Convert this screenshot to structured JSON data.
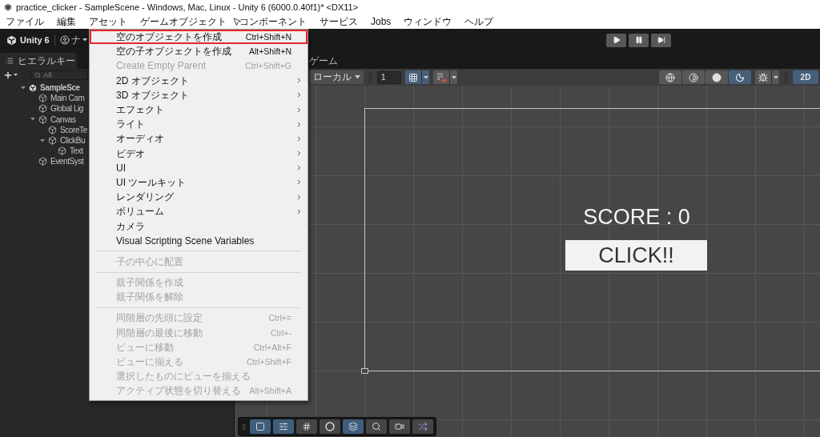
{
  "window": {
    "title": "practice_clicker - SampleScene - Windows, Mac, Linux - Unity 6 (6000.0.40f1)* <DX11>"
  },
  "menu_bar": [
    "ファイル",
    "編集",
    "アセット",
    "ゲームオブジェクト",
    "コンポーネント",
    "サービス",
    "Jobs",
    "ウィンドウ",
    "ヘルプ"
  ],
  "toolbar": {
    "product": "Unity 6",
    "account": "ナ",
    "playback": [
      {
        "kind": "play"
      },
      {
        "kind": "pause"
      },
      {
        "kind": "step"
      }
    ]
  },
  "hierarchy": {
    "tab": {
      "label": "ヒエラルキー",
      "selected": true
    },
    "search": {
      "placeholder": "All"
    },
    "tree": [
      {
        "label": "SampleSce",
        "kind": "scene",
        "expanded": true,
        "children": [
          {
            "label": "Main Cam",
            "kind": "object"
          },
          {
            "label": "Global Lig",
            "kind": "object"
          },
          {
            "label": "Canvas",
            "kind": "object",
            "expanded": true,
            "children": [
              {
                "label": "ScoreTe",
                "kind": "object"
              },
              {
                "label": "ClickBu",
                "kind": "object",
                "expanded": true,
                "children": [
                  {
                    "label": "Text",
                    "kind": "object"
                  }
                ]
              }
            ]
          },
          {
            "label": "EventSyst",
            "kind": "object"
          }
        ]
      }
    ]
  },
  "view_tabs": [
    {
      "label": "ゲーム",
      "selected": false
    }
  ],
  "scene_toolbar": {
    "pivot": "ローカル",
    "snap_value": "1",
    "snap_tools": [
      {
        "kind": "grid-snap",
        "on": true
      },
      {
        "kind": "increment-snap",
        "on": false
      }
    ],
    "draw_modes": [
      {
        "kind": "wireframe",
        "selected": false
      },
      {
        "kind": "shaded-wire",
        "selected": false
      },
      {
        "kind": "shaded",
        "selected": false
      },
      {
        "kind": "lit",
        "selected": true
      }
    ],
    "gizmos": {
      "on": false
    },
    "mode_2d": {
      "label": "2D",
      "on": true
    }
  },
  "scene": {
    "score_text": "SCORE : 0",
    "button": "CLICK!!"
  },
  "overlay_tools": [
    {
      "kind": "rect",
      "selected": true
    },
    {
      "kind": "transform",
      "selected": true
    },
    {
      "kind": "grid",
      "selected": false
    },
    {
      "kind": "orbit",
      "selected": false
    },
    {
      "kind": "layers",
      "selected": true
    },
    {
      "kind": "search",
      "selected": false
    },
    {
      "kind": "camera",
      "selected": false
    },
    {
      "kind": "shuffle",
      "selected": false
    }
  ],
  "context_menu": [
    {
      "kind": "item",
      "label": "空のオブジェクトを作成",
      "shortcut": "Ctrl+Shift+N",
      "disabled": false,
      "submenu": false,
      "highlighted": true
    },
    {
      "kind": "item",
      "label": "空の子オブジェクトを作成",
      "shortcut": "Alt+Shift+N",
      "disabled": false,
      "submenu": false,
      "highlighted": false
    },
    {
      "kind": "item",
      "label": "Create Empty Parent",
      "shortcut": "Ctrl+Shift+G",
      "disabled": true,
      "submenu": false,
      "highlighted": false
    },
    {
      "kind": "item",
      "label": "2D オブジェクト",
      "disabled": false,
      "submenu": true,
      "highlighted": false
    },
    {
      "kind": "item",
      "label": "3D オブジェクト",
      "disabled": false,
      "submenu": true,
      "highlighted": false
    },
    {
      "kind": "item",
      "label": "エフェクト",
      "disabled": false,
      "submenu": true,
      "highlighted": false
    },
    {
      "kind": "item",
      "label": "ライト",
      "disabled": false,
      "submenu": true,
      "highlighted": false
    },
    {
      "kind": "item",
      "label": "オーディオ",
      "disabled": false,
      "submenu": true,
      "highlighted": false
    },
    {
      "kind": "item",
      "label": "ビデオ",
      "disabled": false,
      "submenu": true,
      "highlighted": false
    },
    {
      "kind": "item",
      "label": "UI",
      "disabled": false,
      "submenu": true,
      "highlighted": false
    },
    {
      "kind": "item",
      "label": "UI ツールキット",
      "disabled": false,
      "submenu": true,
      "highlighted": false
    },
    {
      "kind": "item",
      "label": "レンダリング",
      "disabled": false,
      "submenu": true,
      "highlighted": false
    },
    {
      "kind": "item",
      "label": "ボリューム",
      "disabled": false,
      "submenu": true,
      "highlighted": false
    },
    {
      "kind": "item",
      "label": "カメラ",
      "disabled": false,
      "submenu": false,
      "highlighted": false
    },
    {
      "kind": "item",
      "label": "Visual Scripting Scene Variables",
      "disabled": false,
      "submenu": false,
      "highlighted": false
    },
    {
      "kind": "separator"
    },
    {
      "kind": "item",
      "label": "子の中心に配置",
      "disabled": true,
      "submenu": false,
      "highlighted": false
    },
    {
      "kind": "separator"
    },
    {
      "kind": "item",
      "label": "親子関係を作成",
      "disabled": true,
      "submenu": false,
      "highlighted": false
    },
    {
      "kind": "item",
      "label": "親子関係を解除",
      "disabled": true,
      "submenu": false,
      "highlighted": false
    },
    {
      "kind": "separator"
    },
    {
      "kind": "item",
      "label": "同階層の先頭に設定",
      "shortcut": "Ctrl+=",
      "disabled": true,
      "submenu": false,
      "highlighted": false
    },
    {
      "kind": "item",
      "label": "同階層の最後に移動",
      "shortcut": "Ctrl+-",
      "disabled": true,
      "submenu": false,
      "highlighted": false
    },
    {
      "kind": "item",
      "label": "ビューに移動",
      "shortcut": "Ctrl+Alt+F",
      "disabled": true,
      "submenu": false,
      "highlighted": false
    },
    {
      "kind": "item",
      "label": "ビューに揃える",
      "shortcut": "Ctrl+Shift+F",
      "disabled": true,
      "submenu": false,
      "highlighted": false
    },
    {
      "kind": "item",
      "label": "選択したものにビューを揃える",
      "disabled": true,
      "submenu": false,
      "highlighted": false
    },
    {
      "kind": "item",
      "label": "アクティブ状態を切り替える",
      "shortcut": "Alt+Shift+A",
      "disabled": true,
      "submenu": false,
      "highlighted": false
    }
  ]
}
